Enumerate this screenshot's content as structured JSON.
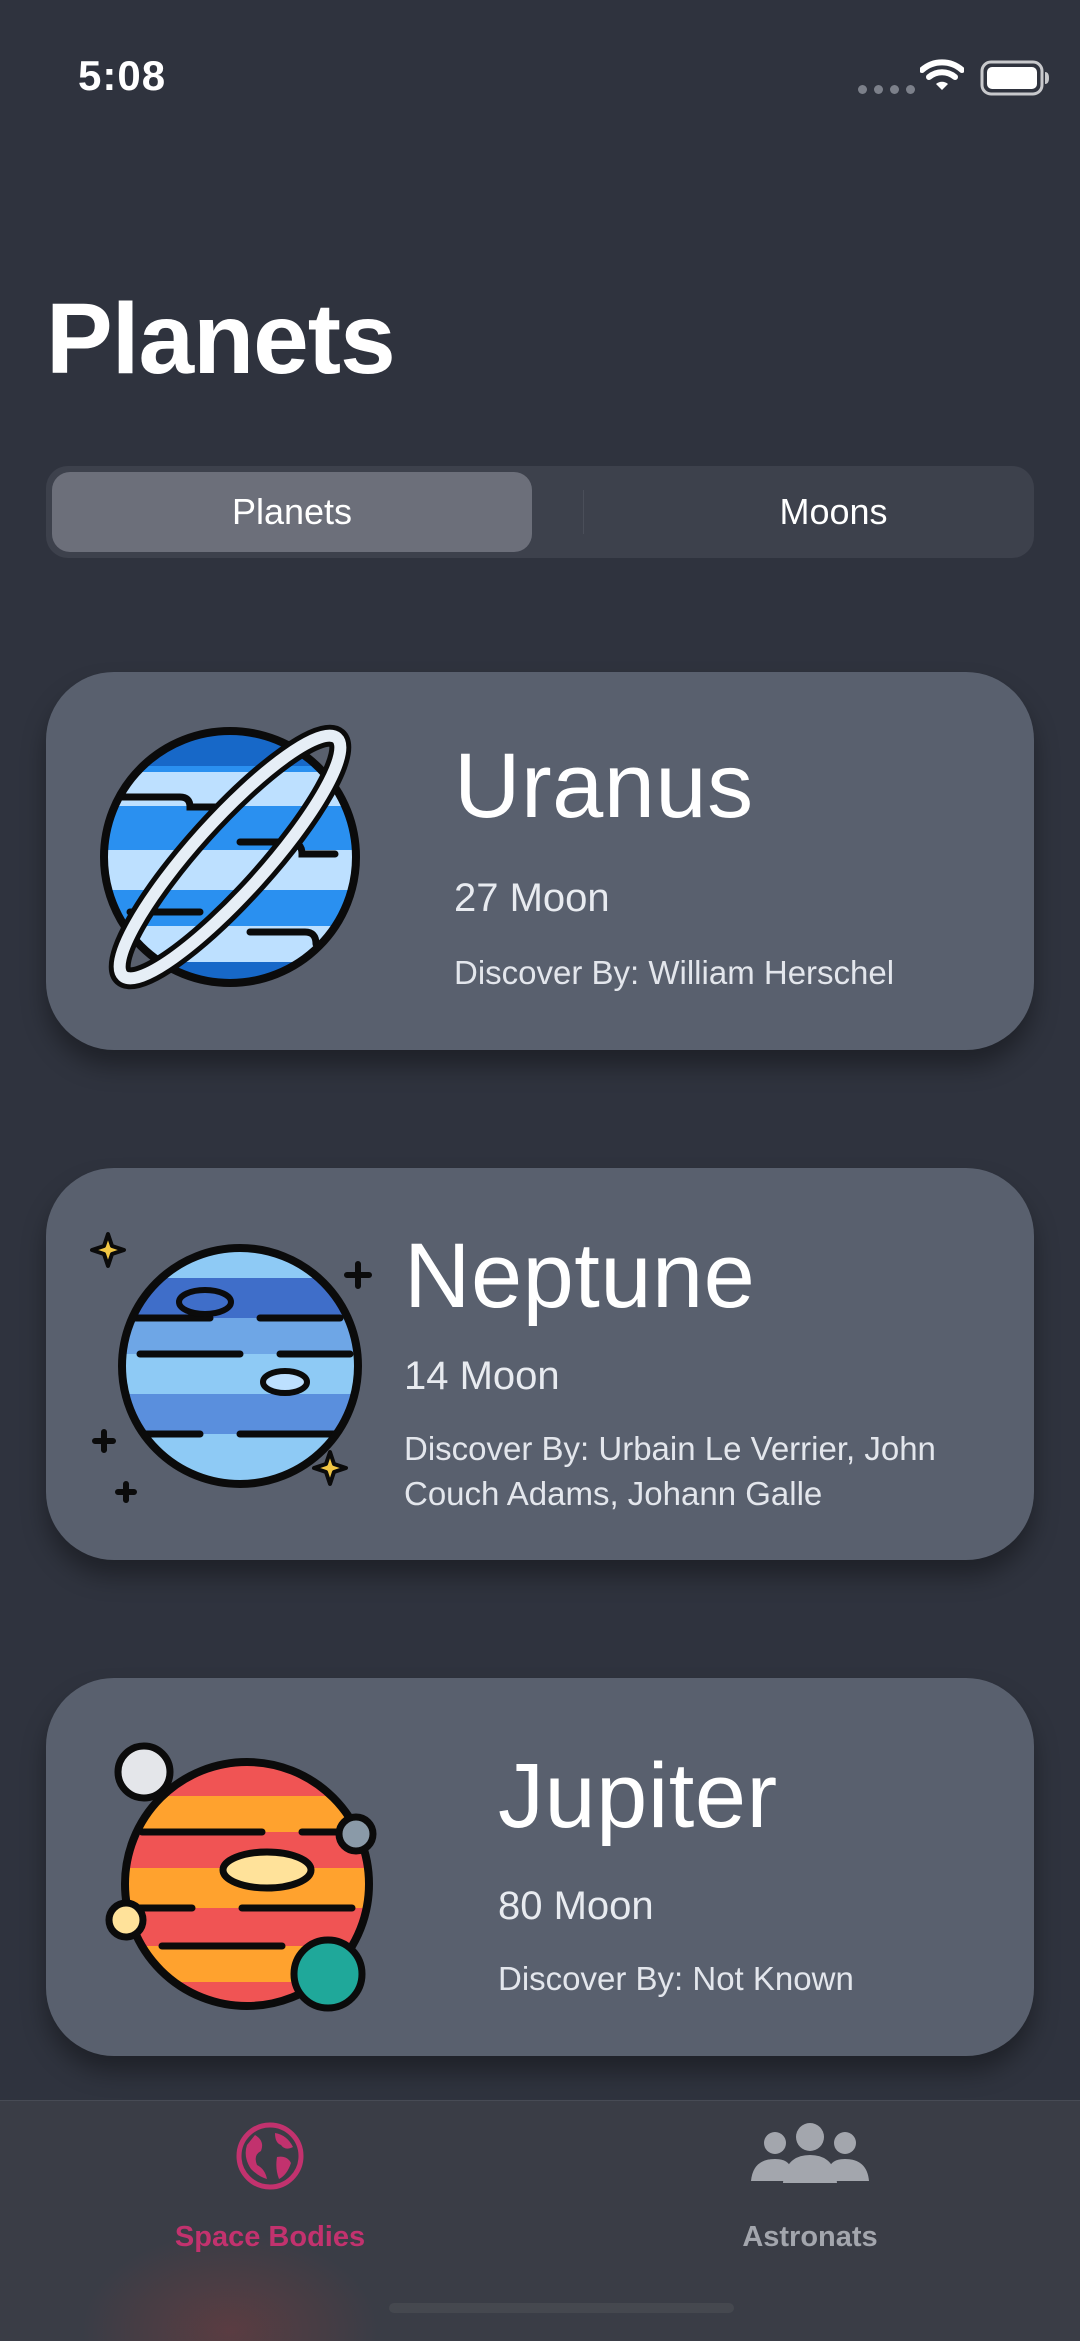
{
  "status_bar": {
    "time": "5:08"
  },
  "page": {
    "title": "Planets"
  },
  "segments": {
    "active": "Planets",
    "inactive": "Moons"
  },
  "planets": [
    {
      "name": "Uranus",
      "moons": "27 Moon",
      "discovered_by": "Discover By: William Herschel",
      "icon": "uranus-icon"
    },
    {
      "name": "Neptune",
      "moons": "14 Moon",
      "discovered_by": "Discover By: Urbain Le Verrier, John Couch Adams, Johann Galle",
      "icon": "neptune-icon"
    },
    {
      "name": "Jupiter",
      "moons": "80 Moon",
      "discovered_by": "Discover By: Not Known",
      "icon": "jupiter-icon"
    }
  ],
  "tab_bar": {
    "items": [
      {
        "label": "Space Bodies",
        "icon": "globe-icon",
        "selected": true
      },
      {
        "label": "Astronats",
        "icon": "people-icon",
        "selected": false
      }
    ]
  },
  "colors": {
    "background": "#2f333e",
    "card": "#59606e",
    "accent": "#c2326e",
    "tab_inactive": "#a3a6ad"
  }
}
